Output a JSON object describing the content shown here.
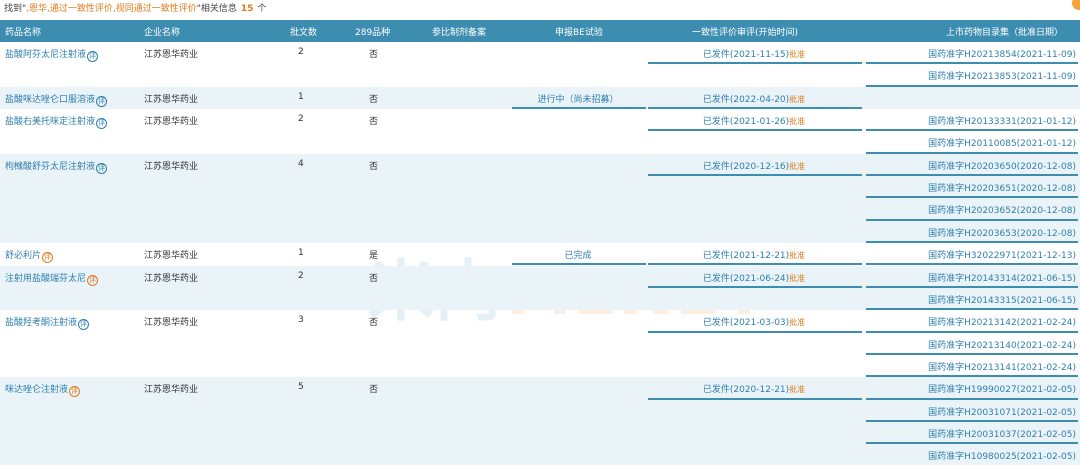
{
  "search": {
    "prefix": "找到\"",
    "keyword": ",恩华,通过一致性评价,视同通过一致性评价",
    "suffix": "\"相关信息",
    "count": "15",
    "unit": "个"
  },
  "columns": [
    "药品名称",
    "企业名称",
    "批文数",
    "289品种",
    "参比制剂备案",
    "申报BE试验",
    "一致性评价审评(开始时间)",
    "上市药物目录集（批准日期）"
  ],
  "rows": [
    {
      "name": "盐酸阿芬太尼注射液",
      "tag": "评",
      "tag_color": "blue",
      "company": "江苏恩华药业",
      "batches": "2",
      "is289": "否",
      "be": "",
      "consistency": "已发件(2021-11-15)",
      "consistency_status": "批准",
      "approvals": [
        "国药准字H20213854(2021-11-09)",
        "国药准字H20213853(2021-11-09)"
      ]
    },
    {
      "name": "盐酸咪达唑仑口服溶液",
      "tag": "评",
      "tag_color": "blue",
      "company": "江苏恩华药业",
      "batches": "1",
      "is289": "否",
      "be": "进行中（尚未招募）",
      "consistency": "已发件(2022-04-20)",
      "consistency_status": "批准",
      "approvals": []
    },
    {
      "name": "盐酸右美托咪定注射液",
      "tag": "评",
      "tag_color": "blue",
      "company": "江苏恩华药业",
      "batches": "2",
      "is289": "否",
      "be": "",
      "consistency": "已发件(2021-01-26)",
      "consistency_status": "批准",
      "approvals": [
        "国药准字H20133331(2021-01-12)",
        "国药准字H20110085(2021-01-12)"
      ]
    },
    {
      "name": "枸橼酸舒芬太尼注射液",
      "tag": "评",
      "tag_color": "blue",
      "company": "江苏恩华药业",
      "batches": "4",
      "is289": "否",
      "be": "",
      "consistency": "已发件(2020-12-16)",
      "consistency_status": "批准",
      "approvals": [
        "国药准字H20203650(2020-12-08)",
        "国药准字H20203651(2020-12-08)",
        "国药准字H20203652(2020-12-08)",
        "国药准字H20203653(2020-12-08)"
      ]
    },
    {
      "name": "舒必利片",
      "tag": "评",
      "tag_color": "orange",
      "company": "江苏恩华药业",
      "batches": "1",
      "is289": "是",
      "be": "已完成",
      "consistency": "已发件(2021-12-21)",
      "consistency_status": "批准",
      "approvals": [
        "国药准字H32022971(2021-12-13)"
      ]
    },
    {
      "name": "注射用盐酸瑞芬太尼",
      "tag": "评",
      "tag_color": "orange",
      "company": "江苏恩华药业",
      "batches": "2",
      "is289": "否",
      "be": "",
      "consistency": "已发件(2021-06-24)",
      "consistency_status": "批准",
      "approvals": [
        "国药准字H20143314(2021-06-15)",
        "国药准字H20143315(2021-06-15)"
      ]
    },
    {
      "name": "盐酸羟考酮注射液",
      "tag": "评",
      "tag_color": "blue",
      "company": "江苏恩华药业",
      "batches": "3",
      "is289": "否",
      "be": "",
      "consistency": "已发件(2021-03-03)",
      "consistency_status": "批准",
      "approvals": [
        "国药准字H20213142(2021-02-24)",
        "国药准字H20213140(2021-02-24)",
        "国药准字H20213141(2021-02-24)"
      ]
    },
    {
      "name": "咪达唑仑注射液",
      "tag": "评",
      "tag_color": "orange",
      "company": "江苏恩华药业",
      "batches": "5",
      "is289": "否",
      "be": "",
      "consistency": "已发件(2020-12-21)",
      "consistency_status": "批准",
      "approvals": [
        "国药准字H19990027(2021-02-05)",
        "国药准字H20031071(2021-02-05)",
        "国药准字H20031037(2021-02-05)",
        "国药准字H10980025(2021-02-05)"
      ]
    }
  ],
  "watermark": {
    "cn": "米内",
    "en": "MENET"
  }
}
